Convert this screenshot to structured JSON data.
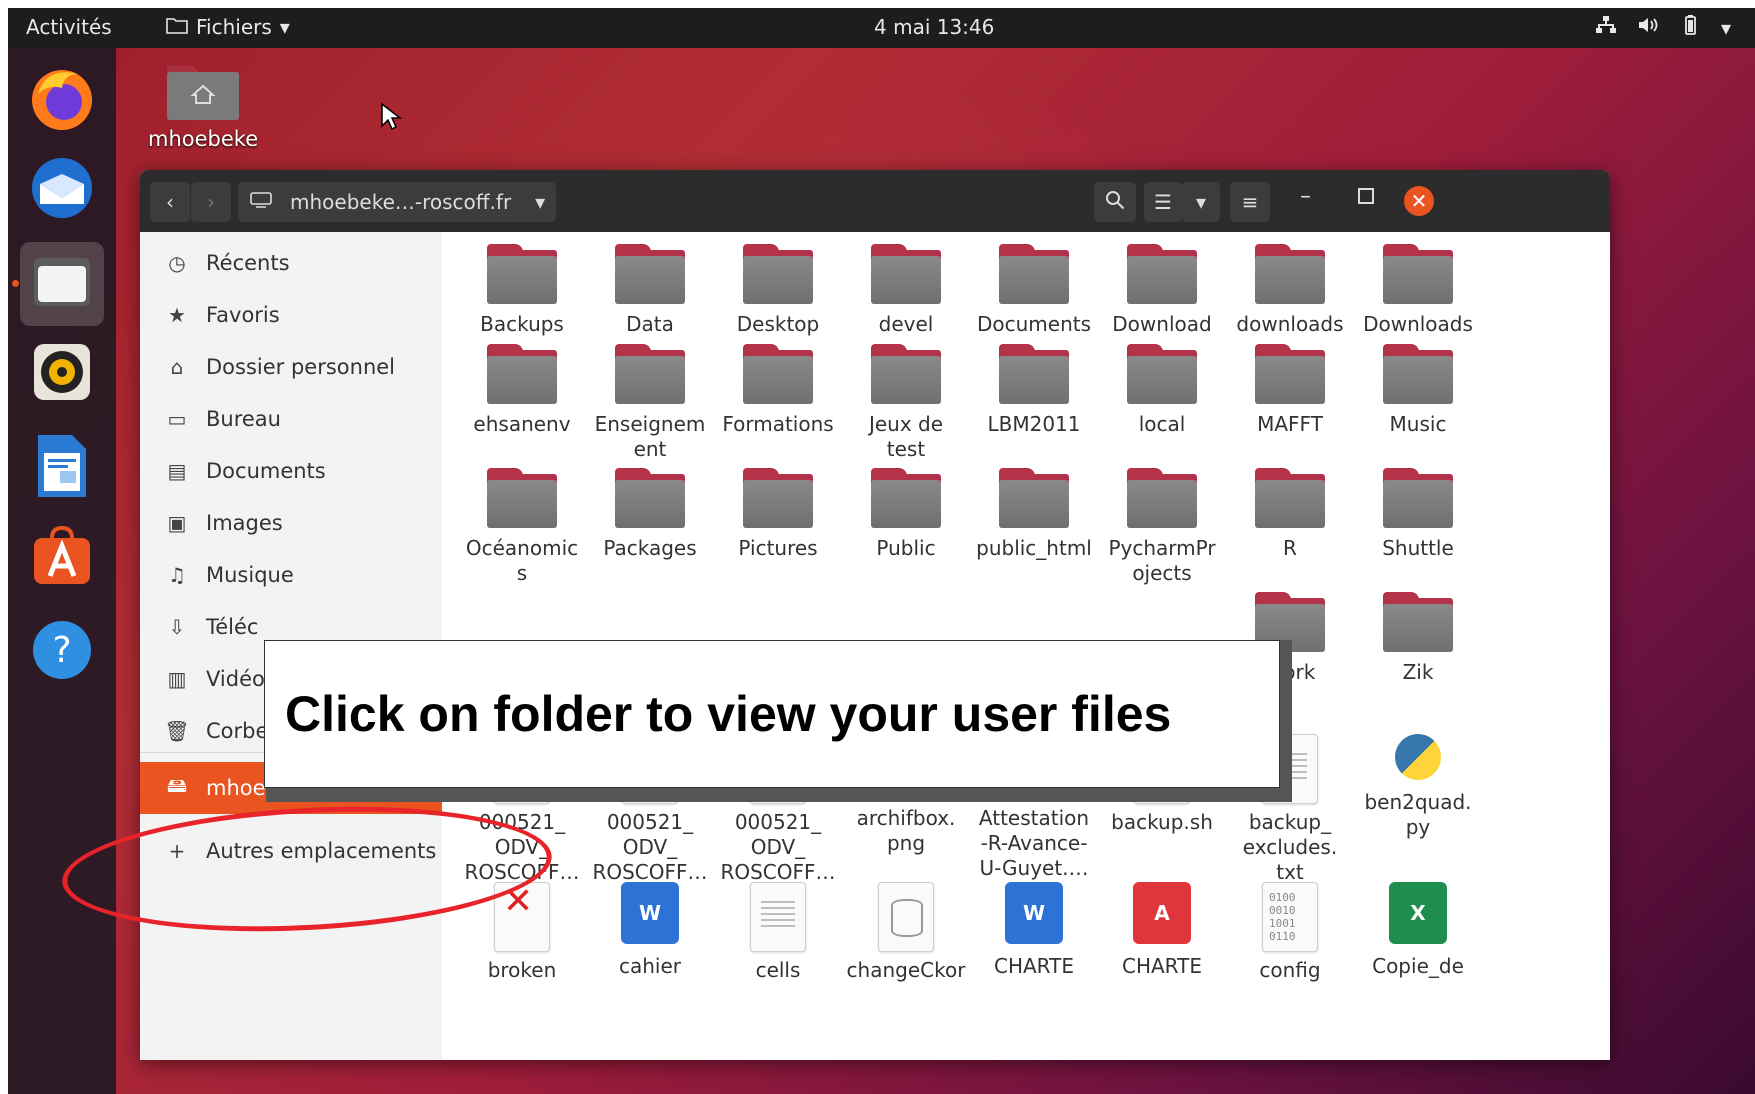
{
  "topbar": {
    "activities": "Activités",
    "app_menu": "Fichiers",
    "clock": "4 mai  13:46"
  },
  "desktop": {
    "home_icon_label": "mhoebeke"
  },
  "window": {
    "location_path": "mhoebeke…-roscoff.fr"
  },
  "sidebar": {
    "items": [
      {
        "label": "Récents",
        "icon": "clock-icon"
      },
      {
        "label": "Favoris",
        "icon": "star-icon"
      },
      {
        "label": "Dossier personnel",
        "icon": "home-icon"
      },
      {
        "label": "Bureau",
        "icon": "desktop-icon"
      },
      {
        "label": "Documents",
        "icon": "document-icon"
      },
      {
        "label": "Images",
        "icon": "image-icon"
      },
      {
        "label": "Musique",
        "icon": "music-icon"
      },
      {
        "label": "Téléc",
        "icon": "download-icon"
      },
      {
        "label": "Vidéo",
        "icon": "video-icon"
      },
      {
        "label": "Corbei",
        "icon": "trash-icon"
      }
    ],
    "mount": "mhoebeke sur …",
    "other_locations": "Autres emplacements"
  },
  "files": {
    "folders_row1": [
      "Backups",
      "Data",
      "Desktop",
      "devel",
      "Documents",
      "Download",
      "downloads",
      "Downloads"
    ],
    "folders_row2": [
      "ehsanenv",
      "Enseignem\nent",
      "Formations",
      "Jeux de\ntest",
      "LBM2011",
      "local",
      "MAFFT",
      "Music"
    ],
    "folders_row3": [
      "Océanomic\ns",
      "Packages",
      "Pictures",
      "Public",
      "public_html",
      "PycharmPr\nojects",
      "R",
      "Shuttle"
    ],
    "folders_row4": [
      "Work",
      "Zik"
    ],
    "files_row5": [
      {
        "name": "000521_\nODV_\nROSCOFF…",
        "kind": "text"
      },
      {
        "name": "000521_\nODV_\nROSCOFF…",
        "kind": "text"
      },
      {
        "name": "000521_\nODV_\nROSCOFF…",
        "kind": "text"
      },
      {
        "name": "archifbox.\npng",
        "kind": "image"
      },
      {
        "name": "Attestation\n-R-Avance-\nU-Guyet.…",
        "kind": "word"
      },
      {
        "name": "backup.sh",
        "kind": "script"
      },
      {
        "name": "backup_\nexcludes.\ntxt",
        "kind": "text"
      },
      {
        "name": "ben2quad.\npy",
        "kind": "python"
      }
    ],
    "files_row6": [
      "broken",
      "cahier",
      "cells",
      "changeCkor",
      "CHARTE",
      "CHARTE",
      "config",
      "Copie_de"
    ]
  },
  "callout": {
    "text": "Click on folder to view your user files"
  },
  "colors": {
    "accent": "#e95420",
    "annotation": "#e8232a"
  }
}
